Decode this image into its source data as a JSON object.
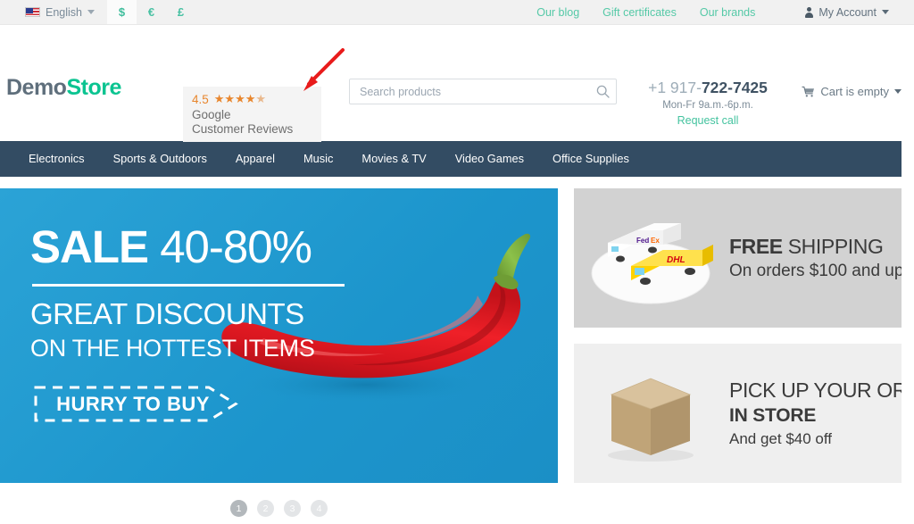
{
  "topbar": {
    "language": "English",
    "language_icon": "us-flag-icon",
    "currencies": [
      {
        "symbol": "$",
        "name": "usd",
        "active": true
      },
      {
        "symbol": "€",
        "name": "eur",
        "active": false
      },
      {
        "symbol": "£",
        "name": "gbp",
        "active": false
      }
    ],
    "links": [
      {
        "label": "Our blog",
        "name": "our-blog"
      },
      {
        "label": "Gift certificates",
        "name": "gift-certificates"
      },
      {
        "label": "Our brands",
        "name": "our-brands"
      }
    ],
    "account_label": "My Account",
    "link_color": "#55c9a7"
  },
  "header": {
    "logo_first": "Demo",
    "logo_second": "Store",
    "logo_accent_color": "#0bc491",
    "reviews": {
      "score": "4.5",
      "stars": "★★★★",
      "half_star": "★",
      "line1": "Google",
      "line2": "Customer Reviews",
      "star_color": "#e8862d"
    },
    "search": {
      "placeholder": "Search products",
      "value": ""
    },
    "phone_prefix": "+1 917-",
    "phone_main": "722-7425",
    "hours": "Mon-Fr 9a.m.-6p.m.",
    "request_call": "Request call",
    "cart_label": "Cart is empty"
  },
  "nav": {
    "background": "#334c63",
    "items": [
      {
        "label": "Electronics",
        "name": "electronics"
      },
      {
        "label": "Sports & Outdoors",
        "name": "sports-outdoors"
      },
      {
        "label": "Apparel",
        "name": "apparel"
      },
      {
        "label": "Music",
        "name": "music"
      },
      {
        "label": "Movies & TV",
        "name": "movies-tv"
      },
      {
        "label": "Video Games",
        "name": "video-games"
      },
      {
        "label": "Office Supplies",
        "name": "office-supplies"
      }
    ]
  },
  "hero": {
    "background_color": "#1f9bd0",
    "title_bold": "SALE ",
    "title_light": "40-80%",
    "subtitle": "GREAT DISCOUNTS",
    "subtitle2": "ON THE HOTTEST ITEMS",
    "cta_label": "HURRY TO BUY",
    "slides": [
      {
        "label": "1",
        "active": true
      },
      {
        "label": "2",
        "active": false
      },
      {
        "label": "3",
        "active": false
      },
      {
        "label": "4",
        "active": false
      }
    ]
  },
  "banners": [
    {
      "name": "free-shipping",
      "art": "delivery-trucks-icon",
      "line1_bold": "FREE",
      "line1_rest": " SHIPPING",
      "line2": "On orders $100 and up",
      "background": "#d2d2d2"
    },
    {
      "name": "pick-up-in-store",
      "art": "cardboard-box-icon",
      "line1": "PICK UP YOUR ORDER",
      "line2": "IN STORE",
      "line3": "And get $40 off",
      "background": "#efefef"
    }
  ],
  "annotation": {
    "name": "red-arrow-pointer",
    "color": "#e81b1b",
    "points_to": "google-customer-reviews-badge"
  }
}
